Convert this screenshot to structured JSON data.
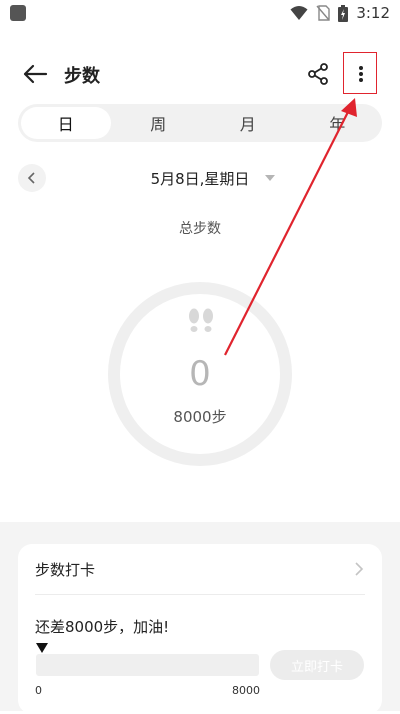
{
  "status_bar": {
    "time": "3:12"
  },
  "header": {
    "title": "步数"
  },
  "tabs": [
    {
      "label": "日",
      "active": true
    },
    {
      "label": "周",
      "active": false
    },
    {
      "label": "月",
      "active": false
    },
    {
      "label": "年",
      "active": false
    }
  ],
  "date_selector": {
    "date": "5月8日,星期日"
  },
  "summary": {
    "label": "总步数",
    "steps": "0",
    "goal": "8000步",
    "progress_fraction": 0
  },
  "checkin_card": {
    "title": "步数打卡",
    "remaining_text": "还差8000步，加油!",
    "min": "0",
    "max": "8000",
    "progress_fraction": 0,
    "button_label": "立即打卡"
  },
  "colors": {
    "annotation_red": "#e0242e",
    "ring_gray": "#efefef",
    "disabled_button": "#ececec"
  }
}
